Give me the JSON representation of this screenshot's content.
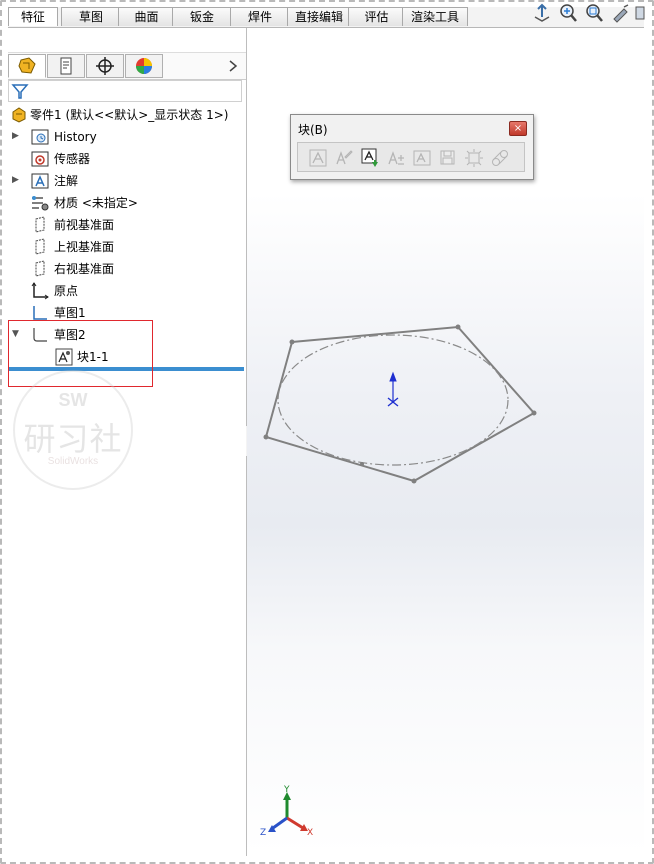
{
  "tabs": [
    "特征",
    "草图",
    "曲面",
    "钣金",
    "焊件",
    "直接编辑",
    "评估",
    "渲染工具"
  ],
  "tree": {
    "root": "零件1 (默认<<默认>_显示状态 1>)",
    "items": [
      "History",
      "传感器",
      "注解",
      "材质 <未指定>",
      "前视基准面",
      "上视基准面",
      "右视基准面",
      "原点",
      "草图1",
      "草图2",
      "块1-1"
    ]
  },
  "block_toolbar": {
    "title": "块(B)",
    "close": "×"
  },
  "watermark": {
    "sw": "SW",
    "cn": "研习社",
    "en": "SolidWorks"
  },
  "triad": {
    "x": "X",
    "y": "Y",
    "z": "Z"
  },
  "colors": {
    "highlight": "#e0282e",
    "tree_bar": "#3b8ed0",
    "sketch_line": "#808080",
    "origin": "#1e2fd0"
  }
}
